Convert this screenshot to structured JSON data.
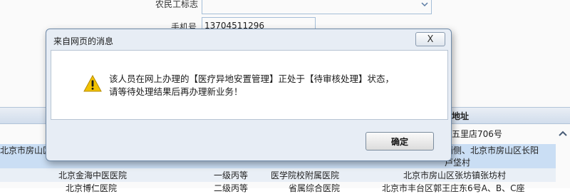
{
  "form": {
    "migrant_label": "农民工标志",
    "phone_label": "手机号",
    "phone_value": "13704511296"
  },
  "table": {
    "address_header": "地址",
    "rows": [
      {
        "address": "五里店706号"
      },
      {
        "name_partial": "北京市房山区",
        "address_line1": "西侧、北京市房山区长阳",
        "address_line2": "芦垡村"
      },
      {
        "name": "北京金海中医医院",
        "level": "一级丙等",
        "type": "医学院校附属医院",
        "address": "北京市房山区张坊镇张坊村"
      },
      {
        "name": "北京博仁医院",
        "level": "二级丙等",
        "type": "省属综合医院",
        "address": "北京市丰台区郭王庄东6号A、B、C座"
      }
    ]
  },
  "dialog": {
    "title": "来自网页的消息",
    "close_glyph": "X",
    "message_line1": "该人员在网上办理的【医疗异地安置管理】正处于【待审核处理】状态，",
    "message_line2": "请等待处理结果后再办理新业务！",
    "ok_label": "确定"
  },
  "colors": {
    "dialog_bg": "#e7edf5",
    "warning": "#f2c200",
    "selected_row": "#cfe3f9"
  },
  "icons": {
    "warning": "warning-triangle-icon",
    "close": "close-icon",
    "dropdown": "chevron-down-icon",
    "scroll": "scroll-up-icon"
  }
}
